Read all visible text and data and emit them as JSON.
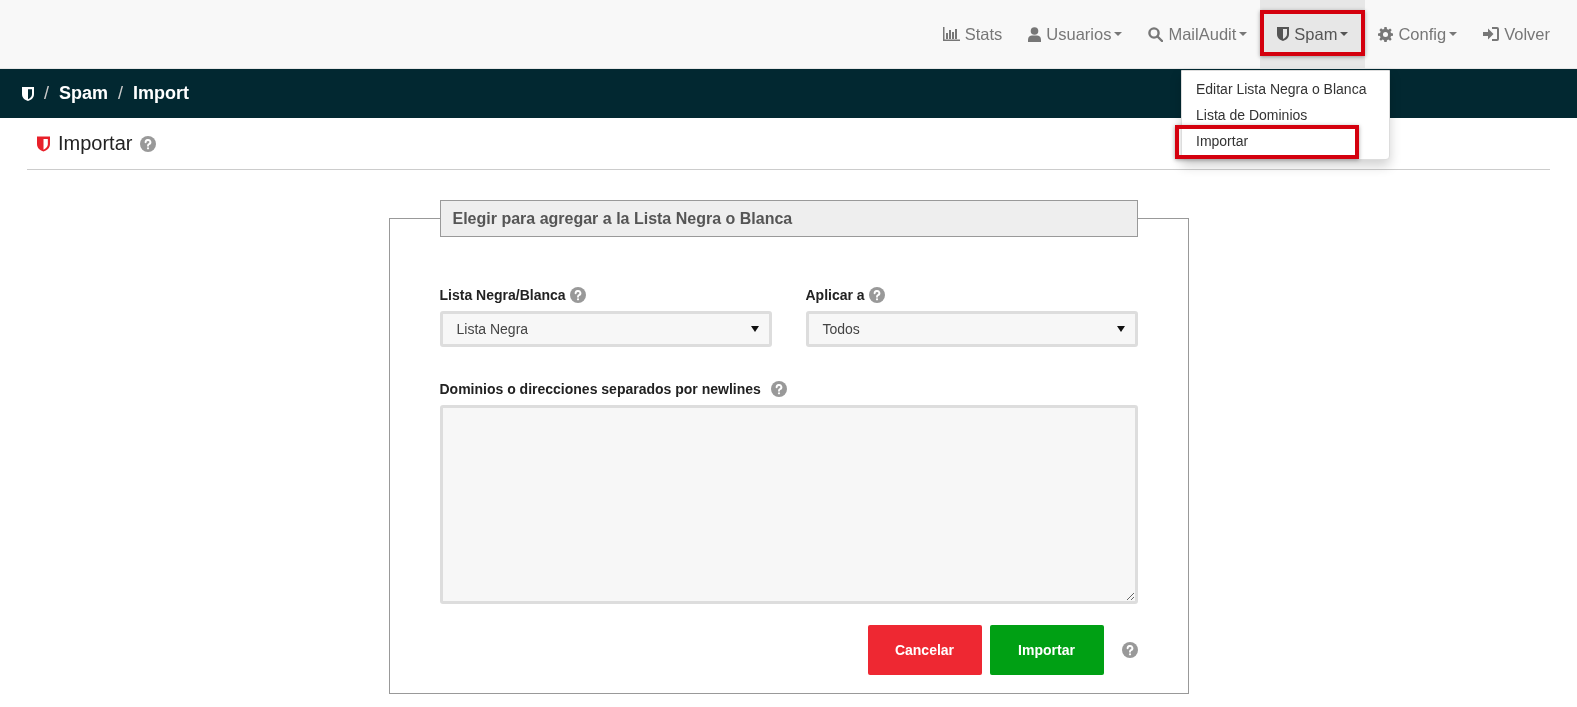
{
  "navbar": {
    "items": [
      {
        "label": "Stats",
        "caret": false,
        "selected": false
      },
      {
        "label": "Usuarios",
        "caret": true,
        "selected": false
      },
      {
        "label": "MailAudit",
        "caret": true,
        "selected": false
      },
      {
        "label": "Spam",
        "caret": true,
        "selected": true
      },
      {
        "label": "Config",
        "caret": true,
        "selected": false
      },
      {
        "label": "Volver",
        "caret": false,
        "selected": false
      }
    ]
  },
  "dropdown": {
    "items": [
      {
        "label": "Editar Lista Negra o Blanca",
        "selected": false
      },
      {
        "label": "Lista de Dominios",
        "selected": false
      },
      {
        "label": "Importar",
        "selected": true
      }
    ]
  },
  "breadcrumb": [
    {
      "separator": "/",
      "label": "Spam"
    },
    {
      "separator": "/",
      "label": "Import"
    }
  ],
  "page_title": "Importar",
  "form": {
    "legend": "Elegir para agregar a la Lista Negra o Blanca",
    "fields": [
      {
        "kind": "select",
        "label": "Lista Negra/Blanca",
        "value": "Lista Negra"
      },
      {
        "kind": "select",
        "label": "Aplicar a",
        "value": "Todos"
      },
      {
        "kind": "textarea",
        "label": "Dominios o direcciones separados por newlines"
      }
    ],
    "buttons": [
      {
        "label": "Cancelar",
        "kind": "danger"
      },
      {
        "label": "Importar",
        "kind": "success"
      }
    ]
  }
}
